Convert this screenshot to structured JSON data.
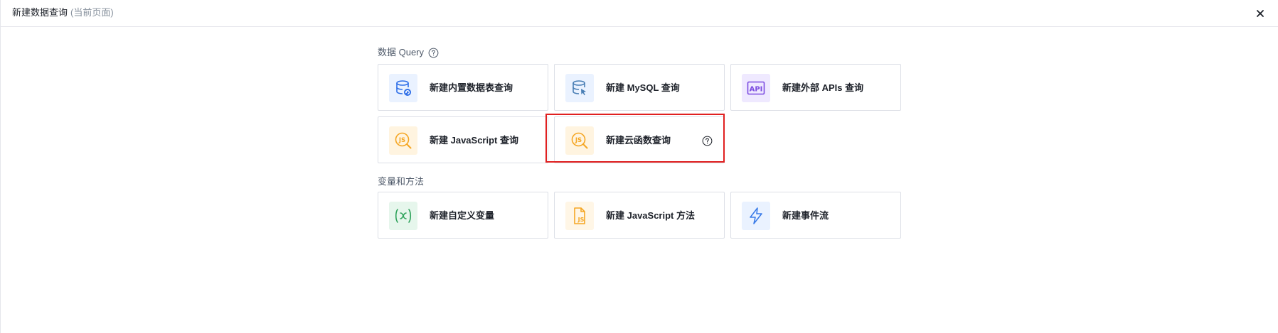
{
  "dialog": {
    "title": "新建数据查询",
    "subtitle": "(当前页面)",
    "close_icon": "close-icon"
  },
  "sections": {
    "query": {
      "label": "数据 Query",
      "help_icon": "question-circle-icon",
      "items": [
        {
          "label": "新建内置数据表查询",
          "icon": "database-refresh-icon",
          "icon_bg": "#eaf2ff",
          "icon_color": "#2f6fe8"
        },
        {
          "label": "新建 MySQL 查询",
          "icon": "database-cursor-icon",
          "icon_bg": "#eaf2ff",
          "icon_color": "#4a7fb5"
        },
        {
          "label": "新建外部 APIs 查询",
          "icon": "api-icon",
          "icon_bg": "#efe9ff",
          "icon_color": "#7b4be0"
        },
        {
          "label": "新建 JavaScript 查询",
          "icon": "js-search-icon",
          "icon_bg": "#fff4e0",
          "icon_color": "#f5a623"
        },
        {
          "label": "新建云函数查询",
          "icon": "js-search-icon",
          "icon_bg": "#fff4e0",
          "icon_color": "#f5a623",
          "help_icon": "question-circle-icon"
        }
      ]
    },
    "vars": {
      "label": "变量和方法",
      "items": [
        {
          "label": "新建自定义变量",
          "icon": "variable-x-icon",
          "icon_bg": "#e6f6ec",
          "icon_color": "#2fa35b"
        },
        {
          "label": "新建 JavaScript 方法",
          "icon": "js-file-icon",
          "icon_bg": "#fff6e6",
          "icon_color": "#f5a623"
        },
        {
          "label": "新建事件流",
          "icon": "lightning-icon",
          "icon_bg": "#eaf2ff",
          "icon_color": "#3a7be8"
        }
      ]
    }
  },
  "colors": {
    "highlight_border": "#e02020",
    "card_border": "#dcdfe6",
    "muted_text": "#86909c"
  }
}
